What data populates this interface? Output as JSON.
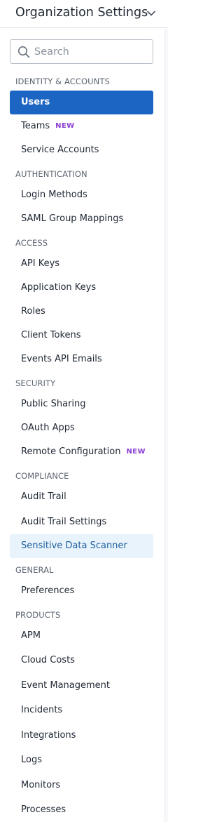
{
  "header": {
    "title": "Organization Settings",
    "chevron_icon": "chevron-down-icon"
  },
  "search": {
    "placeholder": "Search",
    "value": "",
    "icon": "search-icon"
  },
  "colors": {
    "active_bg": "#1d65c3",
    "highlight_bg": "#e9f3fb",
    "new_badge": "#8a3fd1"
  },
  "sections": [
    {
      "title": "IDENTITY & ACCOUNTS",
      "items": [
        {
          "label": "Users",
          "state": "active"
        },
        {
          "label": "Teams",
          "badge": "NEW"
        },
        {
          "label": "Service Accounts"
        }
      ]
    },
    {
      "title": "AUTHENTICATION",
      "items": [
        {
          "label": "Login Methods"
        },
        {
          "label": "SAML Group Mappings"
        }
      ]
    },
    {
      "title": "ACCESS",
      "items": [
        {
          "label": "API Keys"
        },
        {
          "label": "Application Keys"
        },
        {
          "label": "Roles"
        },
        {
          "label": "Client Tokens"
        },
        {
          "label": "Events API Emails"
        }
      ]
    },
    {
      "title": "SECURITY",
      "items": [
        {
          "label": "Public Sharing"
        },
        {
          "label": "OAuth Apps"
        },
        {
          "label": "Remote Configuration",
          "badge": "NEW"
        }
      ]
    },
    {
      "title": "COMPLIANCE",
      "items": [
        {
          "label": "Audit Trail"
        },
        {
          "label": "Audit Trail Settings"
        },
        {
          "label": "Sensitive Data Scanner",
          "state": "highlighted"
        }
      ]
    },
    {
      "title": "GENERAL",
      "items": [
        {
          "label": "Preferences"
        }
      ]
    },
    {
      "title": "PRODUCTS",
      "items": [
        {
          "label": "APM"
        },
        {
          "label": "Cloud Costs"
        },
        {
          "label": "Event Management"
        },
        {
          "label": "Incidents"
        },
        {
          "label": "Integrations"
        },
        {
          "label": "Logs"
        },
        {
          "label": "Monitors"
        },
        {
          "label": "Processes"
        }
      ]
    }
  ]
}
